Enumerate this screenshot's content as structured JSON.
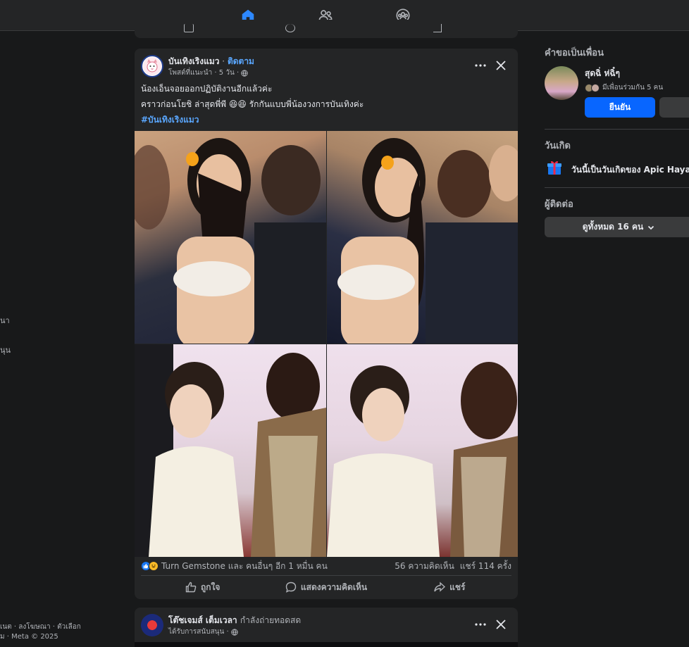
{
  "nav": {
    "items": [
      {
        "name": "home",
        "active": true
      },
      {
        "name": "friends",
        "active": false
      },
      {
        "name": "groups",
        "active": false
      }
    ]
  },
  "left_fragments": {
    "item1": "นา",
    "item2": "นุน",
    "footer_line1": "เนต · ลงโฆษณา · ตัวเลือก",
    "footer_line2": "ม · Meta © 2025"
  },
  "post": {
    "page_name": "บันเทิงเริงแมว",
    "separator": " · ",
    "follow_label": "ติดตาม",
    "meta": "โพสต์ที่แนะนำ · 5 วัน ·",
    "text_line1": "น้องเอ็นจอยออกปฏิบัติงานอีกแล้วค่ะ",
    "text_line2": "คราวก่อนโยชิ ล่าสุดพี่พี 😆😆 รักกันแบบพี่น้องวงการบันเทิงค่ะ",
    "hashtag": "#บันเทิงเริงแมว",
    "reactions_text": "Turn Gemstone และ คนอื่นๆ อีก 1 หมื่น คน",
    "comments": "56 ความคิดเห็น",
    "shares": "แชร์ 114 ครั้ง",
    "like_label": "ถูกใจ",
    "comment_label": "แสดงความคิดเห็น",
    "share_label": "แชร์"
  },
  "post2": {
    "page_name": "โต๊ชเจมส์ เต็มเวลา",
    "status": "กำลังถ่ายทอดสด",
    "meta": "ได้รับการสนับสนุน ·"
  },
  "right": {
    "friend_requests_title": "คำขอเป็นเพื่อน",
    "request_name": "สุดฉิ่ ห่ฉิ๋ๆ",
    "mutual_text": "มีเพื่อนร่วมกัน 5 คน",
    "confirm_label": "ยืนยัน",
    "birthdays_title": "วันเกิด",
    "birthday_text": "วันนี้เป็นวันเกิดของ Apic Haya",
    "contacts_title": "ผู้ติดต่อ",
    "see_all_label": "ดูทั้งหมด 16 คน"
  },
  "colors": {
    "accent": "#0866ff",
    "link": "#5aa7ff",
    "background": "#18191a",
    "card": "#242526"
  }
}
